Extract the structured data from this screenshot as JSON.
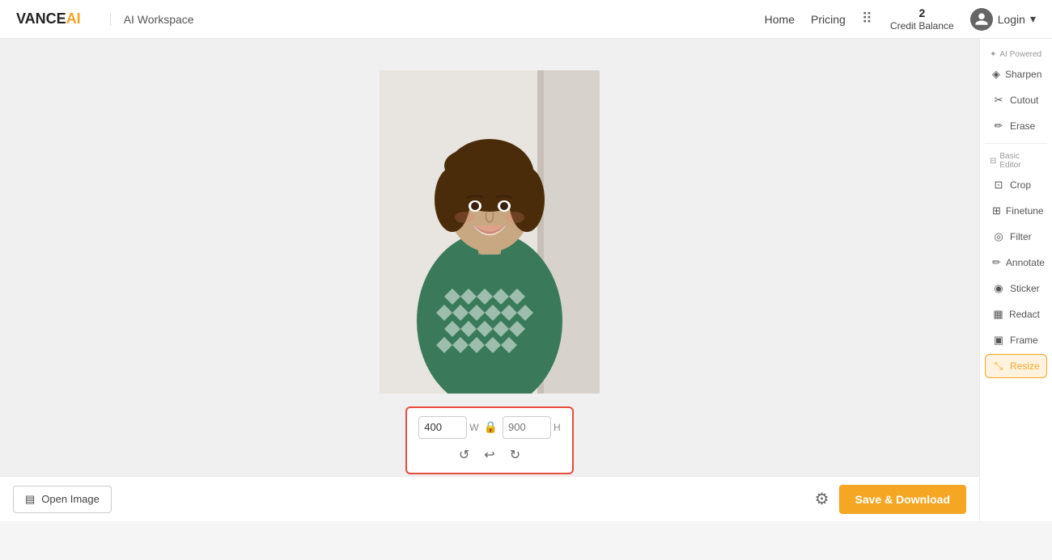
{
  "header": {
    "logo_vance": "VANCE",
    "logo_ai": "AI",
    "workspace": "AI Workspace",
    "nav": {
      "home": "Home",
      "pricing": "Pricing"
    },
    "credit": {
      "number": "2",
      "label": "Credit Balance"
    },
    "login": "Login"
  },
  "sidebar": {
    "section_ai": "AI Powered",
    "items": [
      {
        "id": "sharpen",
        "label": "Sharpen",
        "icon": "◈"
      },
      {
        "id": "cutout",
        "label": "Cutout",
        "icon": "✂"
      },
      {
        "id": "erase",
        "label": "Erase",
        "icon": "✏"
      }
    ],
    "section_basic": "Basic Editor",
    "basic_items": [
      {
        "id": "crop",
        "label": "Crop",
        "icon": "⊡"
      },
      {
        "id": "finetune",
        "label": "Finetune",
        "icon": "⊞"
      },
      {
        "id": "filter",
        "label": "Filter",
        "icon": "◎"
      },
      {
        "id": "annotate",
        "label": "Annotate",
        "icon": "✏"
      },
      {
        "id": "sticker",
        "label": "Sticker",
        "icon": "◉"
      },
      {
        "id": "redact",
        "label": "Redact",
        "icon": "▦"
      },
      {
        "id": "frame",
        "label": "Frame",
        "icon": "▣"
      },
      {
        "id": "resize",
        "label": "Resize",
        "icon": "⤡"
      }
    ]
  },
  "resize_controls": {
    "width_value": "400",
    "width_label": "W",
    "height_placeholder": "900",
    "height_label": "H"
  },
  "bottom_bar": {
    "open_image": "Open Image",
    "save_download": "Save & Download"
  }
}
